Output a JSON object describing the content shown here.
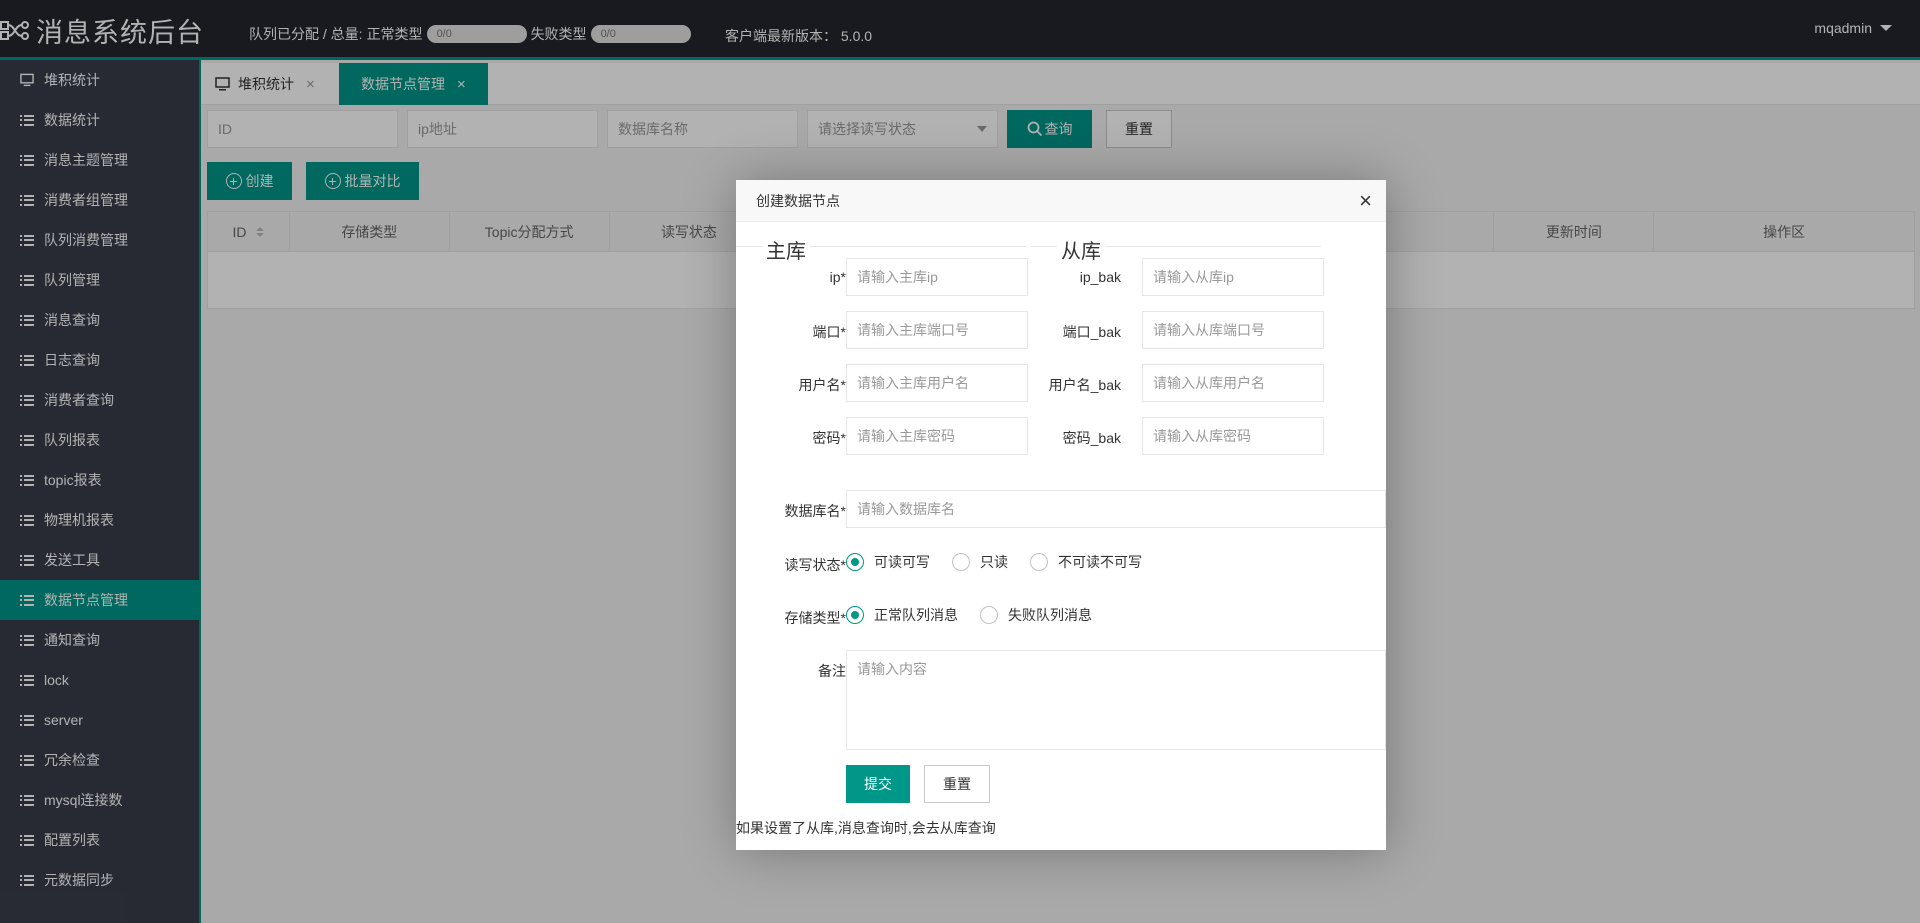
{
  "header": {
    "logo_text": "消息系统后台",
    "queue_assigned_label": "队列已分配 / 总量:",
    "normal_type_label": "正常类型",
    "normal_type_progress": "0/0",
    "failed_type_label": "失败类型",
    "failed_type_progress": "0/0",
    "client_version_label": "客户端最新版本：",
    "client_version": "5.0.0",
    "user": "mqadmin"
  },
  "sidebar": {
    "items": [
      {
        "label": "堆积统计",
        "icon": "monitor-icon"
      },
      {
        "label": "数据统计",
        "icon": "list-icon"
      },
      {
        "label": "消息主题管理",
        "icon": "list-icon"
      },
      {
        "label": "消费者组管理",
        "icon": "list-icon"
      },
      {
        "label": "队列消费管理",
        "icon": "list-icon"
      },
      {
        "label": "队列管理",
        "icon": "list-icon"
      },
      {
        "label": "消息查询",
        "icon": "list-icon"
      },
      {
        "label": "日志查询",
        "icon": "list-icon"
      },
      {
        "label": "消费者查询",
        "icon": "list-icon"
      },
      {
        "label": "队列报表",
        "icon": "list-icon"
      },
      {
        "label": "topic报表",
        "icon": "list-icon"
      },
      {
        "label": "物理机报表",
        "icon": "list-icon"
      },
      {
        "label": "发送工具",
        "icon": "list-icon"
      },
      {
        "label": "数据节点管理",
        "icon": "list-icon",
        "active": true
      },
      {
        "label": "通知查询",
        "icon": "list-icon"
      },
      {
        "label": "lock",
        "icon": "list-icon"
      },
      {
        "label": "server",
        "icon": "list-icon"
      },
      {
        "label": "冗余检查",
        "icon": "list-icon"
      },
      {
        "label": "mysql连接数",
        "icon": "list-icon"
      },
      {
        "label": "配置列表",
        "icon": "list-icon"
      },
      {
        "label": "元数据同步",
        "icon": "list-icon"
      }
    ],
    "active_color": "#009688"
  },
  "tabs": [
    {
      "label": "堆积统计",
      "close": "×"
    },
    {
      "label": "数据节点管理",
      "close": "×"
    }
  ],
  "search": {
    "id_placeholder": "ID",
    "ip_placeholder": "ip地址",
    "dbname_placeholder": "数据库名称",
    "rw_select_placeholder": "请选择读写状态",
    "query_label": "查询",
    "reset_label": "重置"
  },
  "actions": {
    "create_label": "创建",
    "batch_compare_label": "批量对比"
  },
  "table": {
    "columns": [
      "ID",
      "存储类型",
      "Topic分配方式",
      "读写状态",
      "更新时间",
      "操作区"
    ]
  },
  "modal": {
    "title": "创建数据节点",
    "close": "×",
    "master_legend": "主库",
    "slave_legend": "从库",
    "master": {
      "ip_label": "ip*",
      "ip_placeholder": "请输入主库ip",
      "port_label": "端口*",
      "port_placeholder": "请输入主库端口号",
      "user_label": "用户名*",
      "user_placeholder": "请输入主库用户名",
      "pwd_label": "密码*",
      "pwd_placeholder": "请输入主库密码"
    },
    "slave": {
      "ip_label": "ip_bak",
      "ip_placeholder": "请输入从库ip",
      "port_label": "端口_bak",
      "port_placeholder": "请输入从库端口号",
      "user_label": "用户名_bak",
      "user_placeholder": "请输入从库用户名",
      "pwd_label": "密码_bak",
      "pwd_placeholder": "请输入从库密码"
    },
    "dbname_label": "数据库名*",
    "dbname_placeholder": "请输入数据库名",
    "rw_label": "读写状态*",
    "rw_options": [
      "可读可写",
      "只读",
      "不可读不可写"
    ],
    "rw_selected": "可读可写",
    "storage_label": "存储类型*",
    "storage_options": [
      "正常队列消息",
      "失败队列消息"
    ],
    "storage_selected": "正常队列消息",
    "remark_label": "备注",
    "remark_placeholder": "请输入内容",
    "submit_label": "提交",
    "reset_label": "重置",
    "note": "如果设置了从库,消息查询时,会去从库查询"
  }
}
